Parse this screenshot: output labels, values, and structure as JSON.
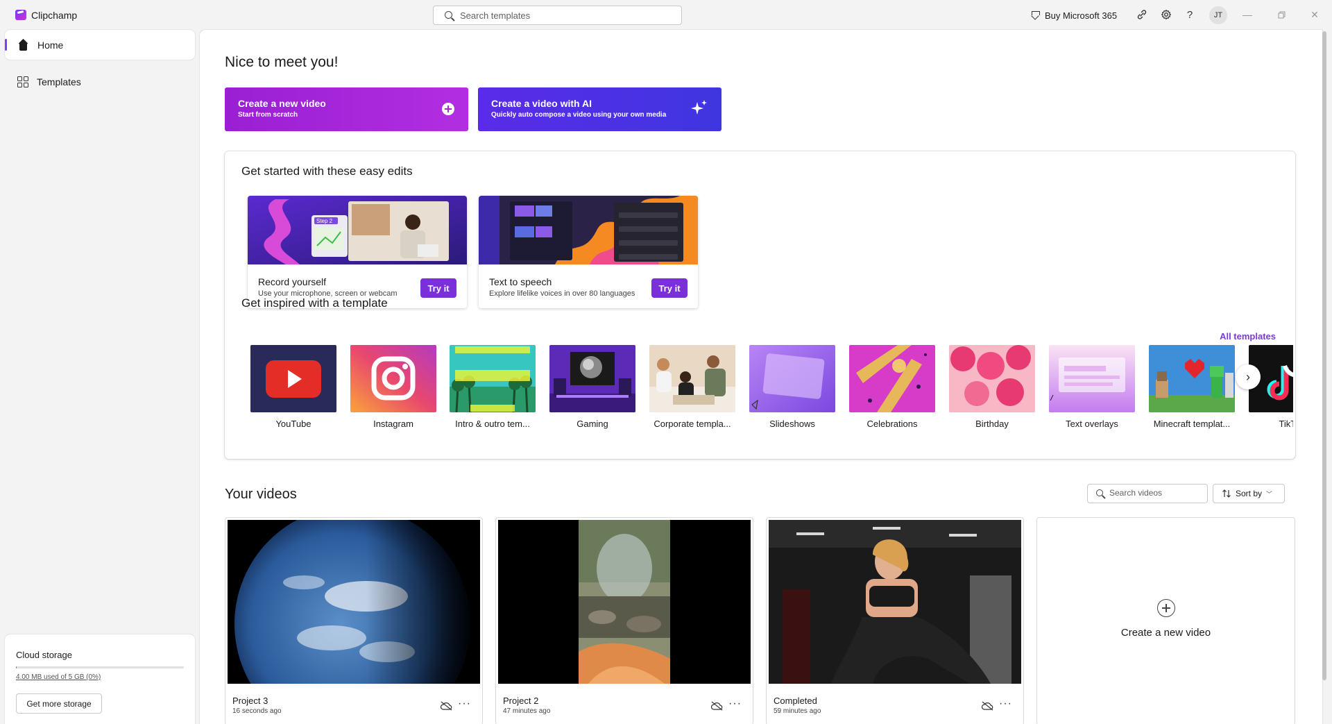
{
  "app": {
    "title": "Clipchamp"
  },
  "topbar": {
    "search_placeholder": "Search templates",
    "buy_label": "Buy Microsoft 365",
    "avatar_initials": "JT"
  },
  "sidebar": {
    "items": [
      {
        "label": "Home",
        "icon": "home-icon",
        "selected": true
      },
      {
        "label": "Templates",
        "icon": "templates-icon",
        "selected": false
      }
    ],
    "storage": {
      "title": "Cloud storage",
      "usage_text": "4.00 MB used of 5 GB (0%)",
      "used_fraction": 0.001,
      "button_label": "Get more storage"
    }
  },
  "main": {
    "greeting": "Nice to meet you!",
    "cta": [
      {
        "title": "Create a new video",
        "subtitle": "Start from scratch",
        "icon": "plus-circle-icon"
      },
      {
        "title": "Create a video with AI",
        "subtitle": "Quickly auto compose a video using your own media",
        "icon": "sparkle-icon"
      }
    ],
    "easy_edits": {
      "heading": "Get started with these easy edits",
      "cards": [
        {
          "title": "Record yourself",
          "subtitle": "Use your microphone, screen or webcam",
          "button": "Try it",
          "thumb_badge": "Step 2"
        },
        {
          "title": "Text to speech",
          "subtitle": "Explore lifelike voices in over 80 languages",
          "button": "Try it"
        }
      ]
    },
    "templates": {
      "heading": "Get inspired with a template",
      "all_link": "All templates",
      "items": [
        {
          "label": "YouTube"
        },
        {
          "label": "Instagram"
        },
        {
          "label": "Intro & outro tem..."
        },
        {
          "label": "Gaming"
        },
        {
          "label": "Corporate templa..."
        },
        {
          "label": "Slideshows"
        },
        {
          "label": "Celebrations"
        },
        {
          "label": "Birthday"
        },
        {
          "label": "Text overlays"
        },
        {
          "label": "Minecraft templat..."
        },
        {
          "label": "TikTok"
        }
      ]
    },
    "videos": {
      "heading": "Your videos",
      "search_placeholder": "Search videos",
      "sort_label": "Sort by",
      "items": [
        {
          "title": "Project 3",
          "time": "16 seconds ago"
        },
        {
          "title": "Project 2",
          "time": "47 minutes ago"
        },
        {
          "title": "Completed",
          "time": "59 minutes ago"
        }
      ],
      "new_video_label": "Create a new video"
    }
  },
  "colors": {
    "accent": "#7a45e6",
    "cta_primary": "#a426dc",
    "cta_ai": "#4a33e6",
    "try_button": "#7b2fd8"
  }
}
